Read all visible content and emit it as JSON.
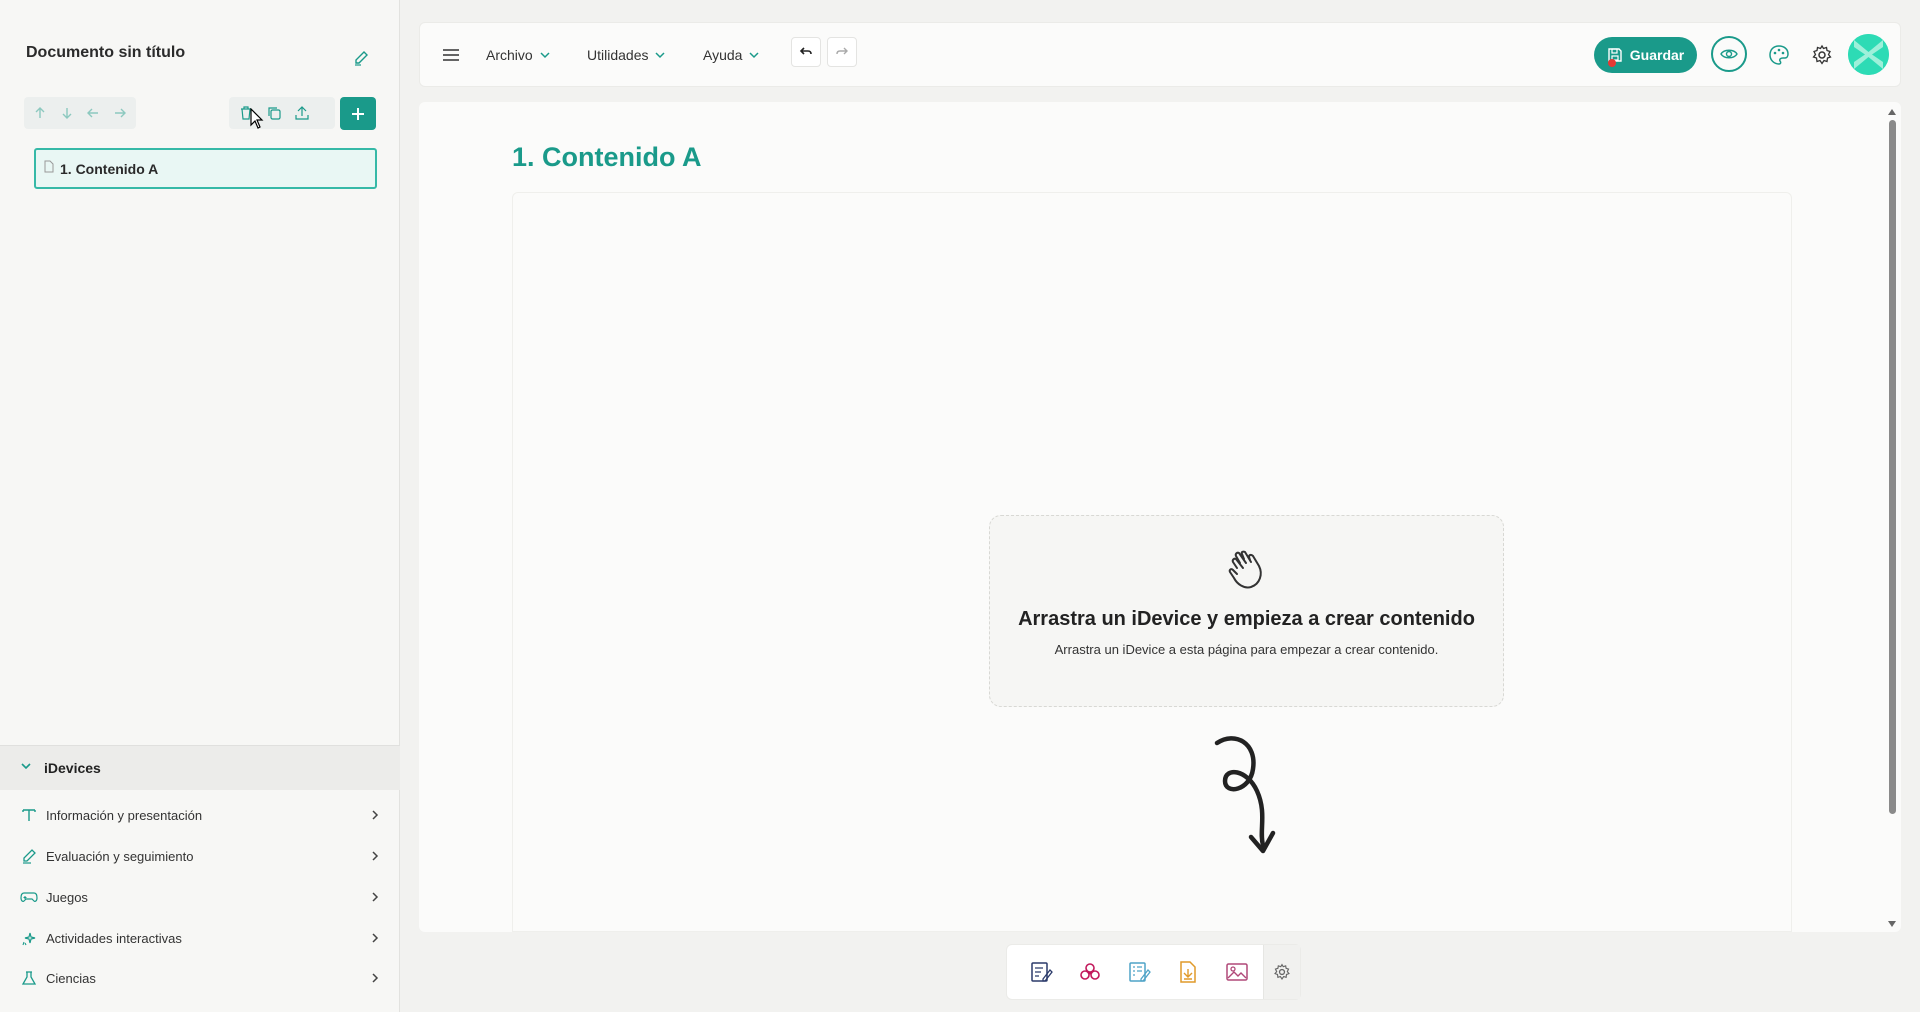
{
  "sidebar": {
    "document_title": "Documento sin título",
    "pages": [
      {
        "label": "1. Contenido A",
        "selected": true
      }
    ],
    "idevices": {
      "title": "iDevices",
      "categories": [
        {
          "label": "Información y presentación",
          "icon": "text-icon"
        },
        {
          "label": "Evaluación y seguimiento",
          "icon": "pencil-icon"
        },
        {
          "label": "Juegos",
          "icon": "gamepad-icon"
        },
        {
          "label": "Actividades interactivas",
          "icon": "sparkle-icon"
        },
        {
          "label": "Ciencias",
          "icon": "flask-icon"
        }
      ]
    }
  },
  "topbar": {
    "menus": [
      "Archivo",
      "Utilidades",
      "Ayuda"
    ],
    "save_label": "Guardar"
  },
  "content": {
    "page_heading": "1. Contenido A",
    "drop_title": "Arrastra un iDevice y empieza a crear contenido",
    "drop_subtitle": "Arrastra un iDevice a esta página para empezar a crear contenido."
  },
  "bottom_toolbar": {
    "icons": [
      "text-idevice-icon",
      "interactive-idevice-icon",
      "form-idevice-icon",
      "download-idevice-icon",
      "image-idevice-icon",
      "settings-icon"
    ]
  },
  "colors": {
    "accent": "#1a9a8a",
    "accent_light": "#36b9a7",
    "unsaved_dot": "#e53935"
  }
}
